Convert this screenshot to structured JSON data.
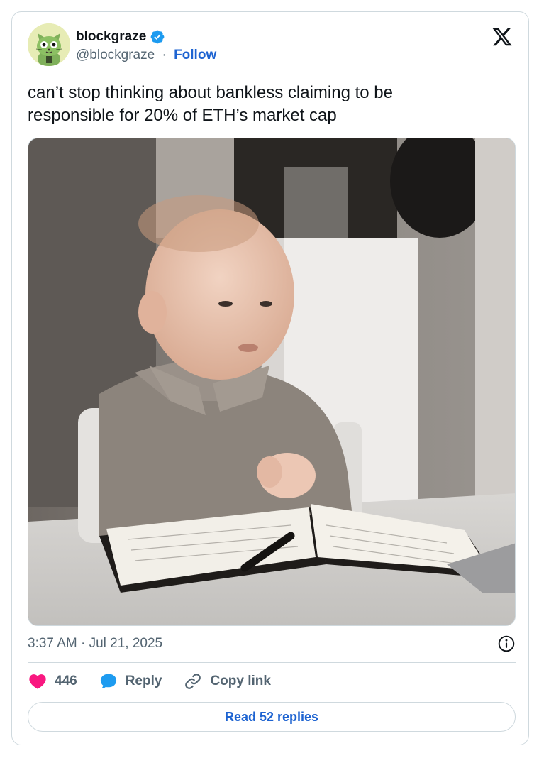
{
  "author": {
    "display_name": "blockgraze",
    "handle": "@blockgraze",
    "separator": "·",
    "follow_label": "Follow",
    "verified": true
  },
  "tweet": {
    "text": "can’t stop thinking about bankless claiming to be responsible for 20% of ETH’s market cap",
    "timestamp": "3:37 AM · Jul 21, 2025"
  },
  "actions": {
    "likes": "446",
    "reply_label": "Reply",
    "copy_link_label": "Copy link"
  },
  "read_replies_label": "Read 52 replies",
  "icons": {
    "platform": "x-logo-icon",
    "verified": "verified-badge-icon",
    "like": "heart-icon",
    "reply": "speech-bubble-icon",
    "copy": "link-icon",
    "info": "info-icon"
  },
  "colors": {
    "accent": "#1d63d1",
    "verified": "#1d9bf0",
    "like": "#f91880",
    "text": "#0f1419",
    "muted": "#536471",
    "border": "#cfd9de"
  }
}
